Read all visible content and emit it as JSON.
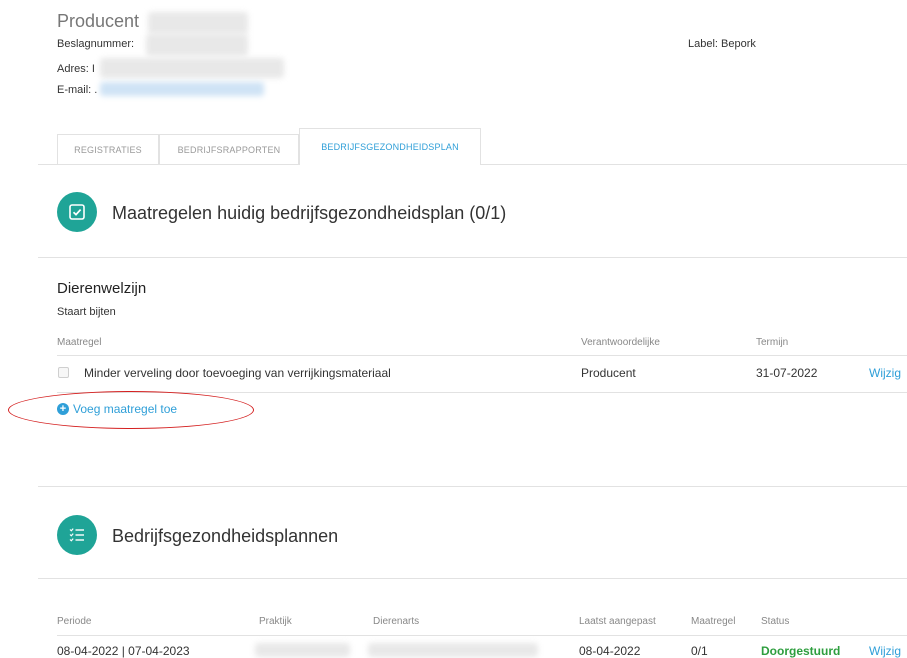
{
  "producer": {
    "title": "Producent",
    "beslagnummer_label": "Beslagnummer:",
    "adres_label": "Adres: I",
    "email_label": "E-mail: .",
    "label_text": "Label: Bepork"
  },
  "tabs": [
    {
      "label": "REGISTRATIES",
      "active": false
    },
    {
      "label": "BEDRIJFSRAPPORTEN",
      "active": false
    },
    {
      "label": "BEDRIJFSGEZONDHEIDSPLAN",
      "active": true
    }
  ],
  "measures": {
    "heading": "Maatregelen huidig bedrijfsgezondheidsplan (0/1)",
    "group_title": "Dierenwelzijn",
    "group_subtitle": "Staart bijten",
    "columns": {
      "maatregel": "Maatregel",
      "verantwoordelijke": "Verantwoordelijke",
      "termijn": "Termijn"
    },
    "rows": [
      {
        "maatregel": "Minder verveling door toevoeging van verrijkingsmateriaal",
        "verantwoordelijke": "Producent",
        "termijn": "31-07-2022",
        "action": "Wijzig"
      }
    ],
    "add_label": "Voeg maatregel toe"
  },
  "plans": {
    "heading": "Bedrijfsgezondheidsplannen",
    "columns": {
      "periode": "Periode",
      "praktijk": "Praktijk",
      "dierenarts": "Dierenarts",
      "laatst_aangepast": "Laatst aangepast",
      "maatregel": "Maatregel",
      "status": "Status"
    },
    "rows": [
      {
        "periode": "08-04-2022 | 07-04-2023",
        "laatst_aangepast": "08-04-2022",
        "maatregel": "0/1",
        "status": "Doorgestuurd",
        "action": "Wijzig"
      }
    ]
  },
  "colors": {
    "accent": "#1fa497",
    "link": "#2f9fd8",
    "status_ok": "#2e9e3e",
    "highlight": "#d42020"
  },
  "icons": [
    "checkbox-icon",
    "checklist-icon",
    "plus-circle-icon"
  ]
}
